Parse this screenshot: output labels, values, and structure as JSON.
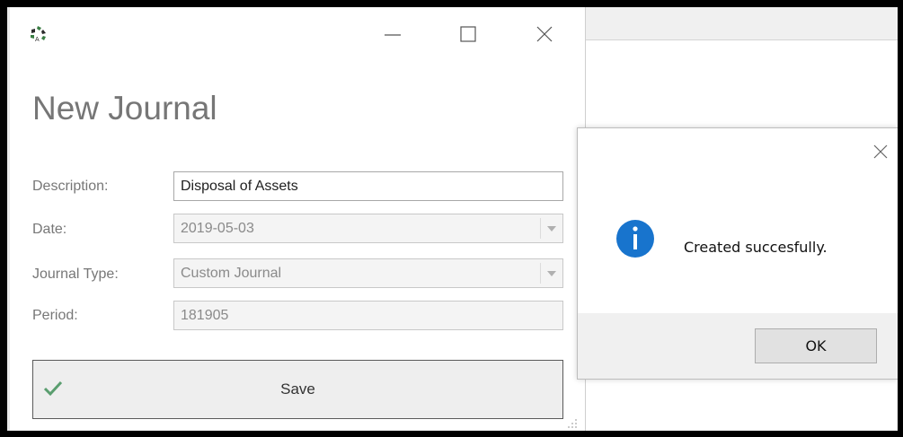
{
  "window": {
    "title": "New Journal",
    "controls": {
      "minimize": "minimize",
      "maximize": "maximize",
      "close": "close"
    }
  },
  "form": {
    "description": {
      "label": "Description:",
      "value": "Disposal of Assets"
    },
    "date": {
      "label": "Date:",
      "value": "2019-05-03"
    },
    "journal_type": {
      "label": "Journal Type:",
      "value": "Custom Journal"
    },
    "period": {
      "label": "Period:",
      "value": "181905"
    },
    "save_label": "Save"
  },
  "dialog": {
    "message": "Created succesfully.",
    "ok_label": "OK",
    "icon": "info-icon"
  },
  "colors": {
    "info_blue": "#1874cd",
    "check_green": "#5a9e6f"
  }
}
